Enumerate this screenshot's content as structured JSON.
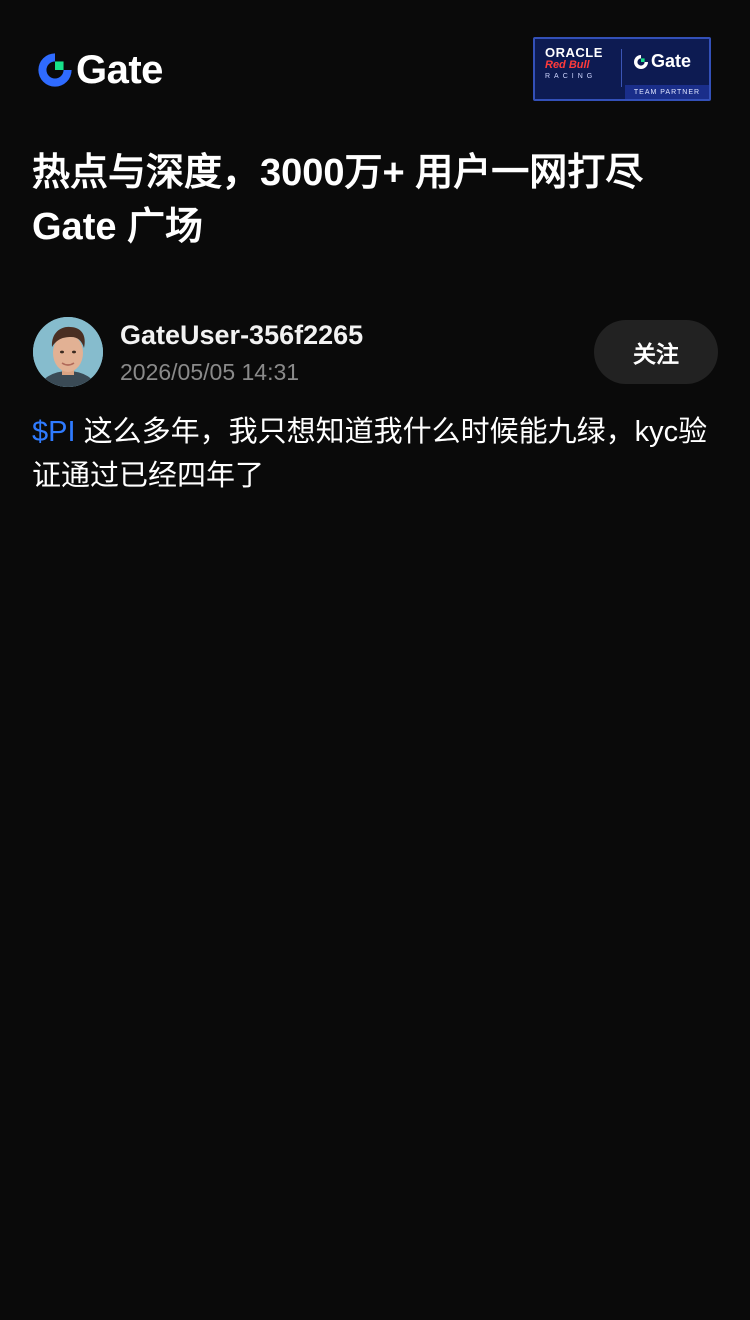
{
  "header": {
    "logo_text": "Gate",
    "partner": {
      "oracle": "ORACLE",
      "redbull": "Red Bull",
      "racing": "RACING",
      "gate": "Gate",
      "tag": "TEAM PARTNER"
    }
  },
  "headline": {
    "line1": "热点与深度，3000万+ 用户一网打尽",
    "line2": "Gate 广场"
  },
  "post": {
    "username": "GateUser-356f2265",
    "timestamp": "2026/05/05 14:31",
    "follow_label": "关注",
    "ticker": "$PI",
    "text": " 这么多年，我只想知道我什么时候能九绿，kyc验证通过已经四年了"
  },
  "colors": {
    "background": "#0a0a0a",
    "accent_blue": "#2f7bff",
    "logo_green": "#17e38a",
    "muted_text": "#8a8a8a",
    "button_bg": "#222222"
  }
}
